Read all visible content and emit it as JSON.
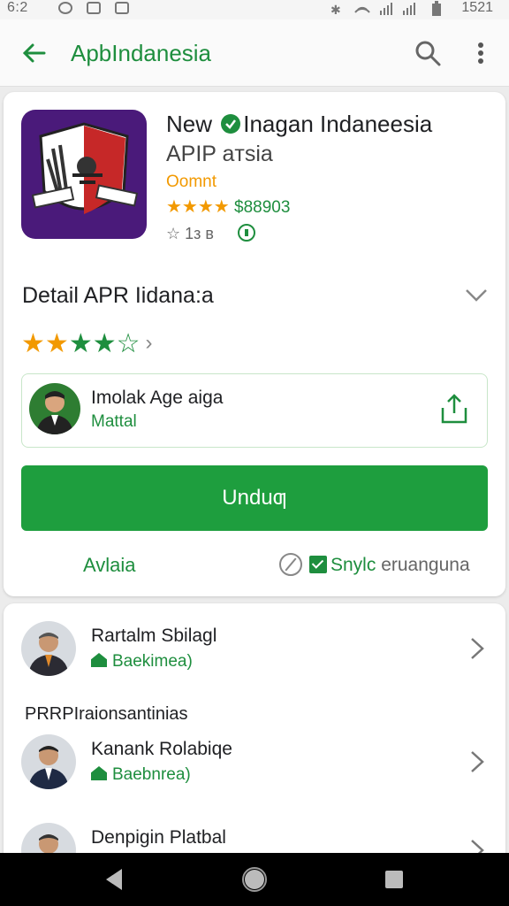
{
  "status_bar": {
    "time": "6:2",
    "clock": "1521"
  },
  "app_bar": {
    "title": "ApbIndanesia"
  },
  "app": {
    "title_part1": "New",
    "title_part2": "Inagan Indaneesia",
    "subtitle": "APIP aтsia",
    "developer": "Oomnt",
    "rating_value": "$88903",
    "meta_text": "☆ 1з в"
  },
  "detail": {
    "title": "Detail APR Iidana:a",
    "stars_filled": 4,
    "stars_total": 5
  },
  "developer_box": {
    "name": "Imolak Age aiga",
    "role": "Mattal"
  },
  "install_button": {
    "label": "Unduƣ"
  },
  "links": {
    "left": "Avlaia",
    "right_green": "Snylc",
    "right_gray": "eruanguna"
  },
  "list": {
    "section_label": "PRRPIraionsantinias",
    "items": [
      {
        "name": "Rartalm Sbilagl",
        "sub": "Baekimea)"
      },
      {
        "name": "Kanank Rolabiqe",
        "sub": "Baebnrea)"
      },
      {
        "name": "Denpigin Platbal",
        "sub": ""
      }
    ]
  },
  "colors": {
    "brand_green": "#1e8e3e",
    "button_green": "#1e9e3e",
    "star_orange": "#f29900",
    "icon_purple": "#4a1a7a"
  }
}
